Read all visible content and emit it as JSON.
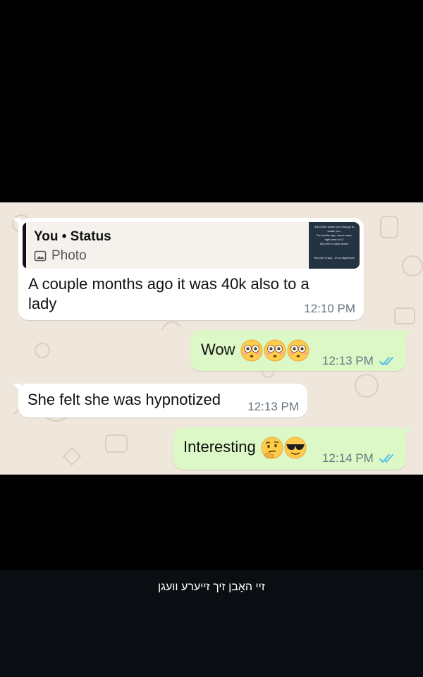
{
  "messages": [
    {
      "id": "m1",
      "direction": "incoming",
      "reply": {
        "title": "You • Status",
        "type_label": "Photo",
        "type_icon": "photo-icon",
        "thumb_lines": [
          "If $13,000 stolen isn't enough to",
          "shake you,",
          "Two weeks ago, same scam,",
          "right here in KJ",
          "$26,000 in cash stolen"
        ],
        "thumb_footer": "This isn't crazy... It's a nightmare!"
      },
      "text_line1": "A couple months ago it was 40k also to a",
      "text_line2": "lady",
      "time": "12:10 PM"
    },
    {
      "id": "m2",
      "direction": "outgoing",
      "text": "Wow",
      "emojis": [
        "flushed-face",
        "flushed-face",
        "flushed-face"
      ],
      "time": "12:13 PM",
      "status": "read"
    },
    {
      "id": "m3",
      "direction": "incoming",
      "text": "She felt she was hypnotized",
      "time": "12:13 PM"
    },
    {
      "id": "m4",
      "direction": "outgoing",
      "text": "Interesting",
      "emojis": [
        "thinking-face",
        "sunglasses-face"
      ],
      "time": "12:14 PM",
      "status": "read"
    }
  ],
  "caption": "זיי האָבן זיך זייערע וועגן",
  "colors": {
    "chat_bg": "#efe7dc",
    "incoming": "#ffffff",
    "outgoing": "#dcf8c6",
    "read_ticks": "#53bdeb",
    "time": "#667781"
  }
}
